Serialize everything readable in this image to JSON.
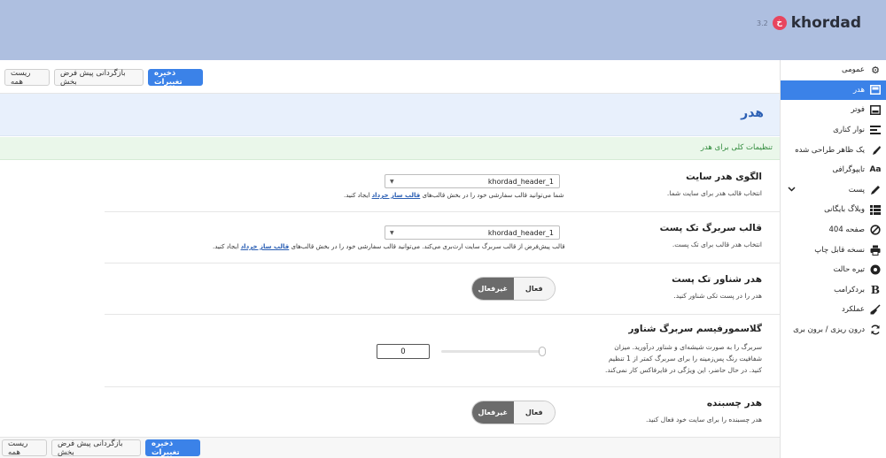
{
  "brand": {
    "name": "khordad",
    "mark": "خ",
    "version": "3.2"
  },
  "actions": {
    "save": "ذخیره تغییرات",
    "restore_section": "بازگردانی پیش فرض بخش",
    "reset_all": "ریست همه"
  },
  "sidebar": {
    "items": [
      {
        "label": "عمومی",
        "icon": "gear-icon"
      },
      {
        "label": "هدر",
        "icon": "header-icon",
        "active": true
      },
      {
        "label": "فوتر",
        "icon": "footer-icon"
      },
      {
        "label": "نوار کناری",
        "icon": "sidebar-lines-icon"
      },
      {
        "label": "یک ظاهر طراحی شده",
        "icon": "brush-icon"
      },
      {
        "label": "تایپوگرافی",
        "icon": "typography-icon"
      },
      {
        "label": "پست",
        "icon": "pen-icon"
      },
      {
        "label": "وبلاگ بایگانی",
        "icon": "list-icon"
      },
      {
        "label": "صفحه 404",
        "icon": "block-icon"
      },
      {
        "label": "نسخه قابل چاپ",
        "icon": "printer-icon"
      },
      {
        "label": "تیره حالت",
        "icon": "moon-icon"
      },
      {
        "label": "بردکرامب",
        "icon": "bold-b-icon"
      },
      {
        "label": "عملکرد",
        "icon": "broom-icon"
      },
      {
        "label": "درون ریزی / برون بری",
        "icon": "sync-icon"
      }
    ]
  },
  "page": {
    "title": "هدر",
    "notice": "تنظیمات کلی برای هدر"
  },
  "settings": {
    "site_header": {
      "title": "الگوی هدر سایت",
      "desc": "انتخاب قالب هدر برای سایت شما.",
      "value": "khordad_header_1",
      "help_pre": "شما می‌توانید قالب سفارشی خود را در بخش قالب‌های",
      "help_link": "قالب ساز خرداد",
      "help_post": "ایجاد کنید."
    },
    "single_header": {
      "title": "قالب سربرگ تک پست",
      "desc": "انتخاب هدر قالب برای تک پست.",
      "value": "khordad_header_1",
      "help_pre": "قالب پیش‌فرض از قالب سربرگ سایت ارث‌بری می‌کند. می‌توانید قالب سفارشی خود را در بخش قالب‌های",
      "help_link": "قالب ساز خرداد",
      "help_post": "ایجاد کنید."
    },
    "floating_single": {
      "title": "هدر شناور تک پست",
      "desc": "هدر را در پست تکی شناور کنید.",
      "on_label": "فعال",
      "off_label": "غیرفعال",
      "enabled": false
    },
    "glassmorphism": {
      "title": "گلاسمورفیسم سربرگ شناور",
      "desc_lines": [
        "سربرگ را به صورت شیشه‌ای و شناور درآورید. میزان",
        "شفافیت رنگ پس‌زمینه را برای سربرگ کمتر از 1 تنظیم",
        "کنید. در حال حاضر، این ویژگی در فایرفاکس کار نمی‌کند."
      ],
      "value": "0"
    },
    "sticky": {
      "title": "هدر چسبنده",
      "desc": "هدر چسبنده را برای سایت خود فعال کنید.",
      "on_label": "فعال",
      "off_label": "غیرفعال",
      "enabled": false
    }
  }
}
